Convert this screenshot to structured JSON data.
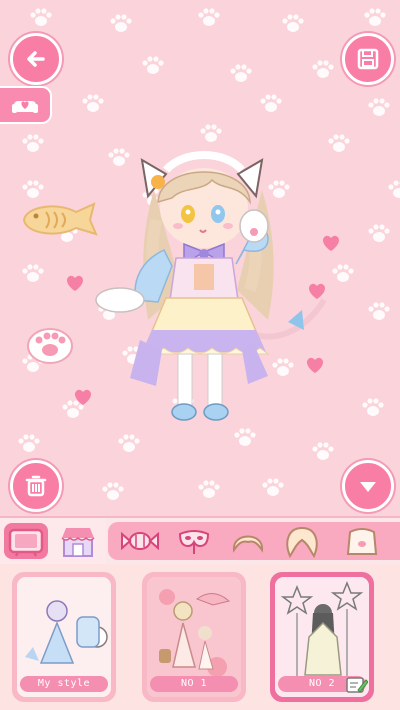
{
  "colors": {
    "accent": "#f97ea6",
    "background": "#fbd3da",
    "category_bar": "#f9a9c0"
  },
  "top_bar": {
    "back_icon": "arrow-left-icon",
    "save_icon": "floppy-disk-icon",
    "wardrobe_icon": "sofa-heart-icon"
  },
  "stage_controls": {
    "delete_icon": "trash-icon",
    "collapse_icon": "triangle-down-icon"
  },
  "categories": {
    "selected": "tv-background",
    "items": [
      {
        "name": "tv-background",
        "icon": "tv-icon"
      },
      {
        "name": "shop-stall",
        "icon": "shop-awning-icon"
      },
      {
        "name": "candy-accessory",
        "icon": "candy-icon"
      },
      {
        "name": "mask",
        "icon": "mask-icon"
      },
      {
        "name": "short-hair",
        "icon": "hair-short-icon"
      },
      {
        "name": "long-hair",
        "icon": "hair-long-icon"
      },
      {
        "name": "top-clothing",
        "icon": "shirt-icon"
      }
    ]
  },
  "styles": [
    {
      "label": "My style",
      "selected": false
    },
    {
      "label": "NO 1",
      "selected": false
    },
    {
      "label": "NO 2",
      "selected": true,
      "edit_icon": "pencil-note-icon"
    }
  ]
}
